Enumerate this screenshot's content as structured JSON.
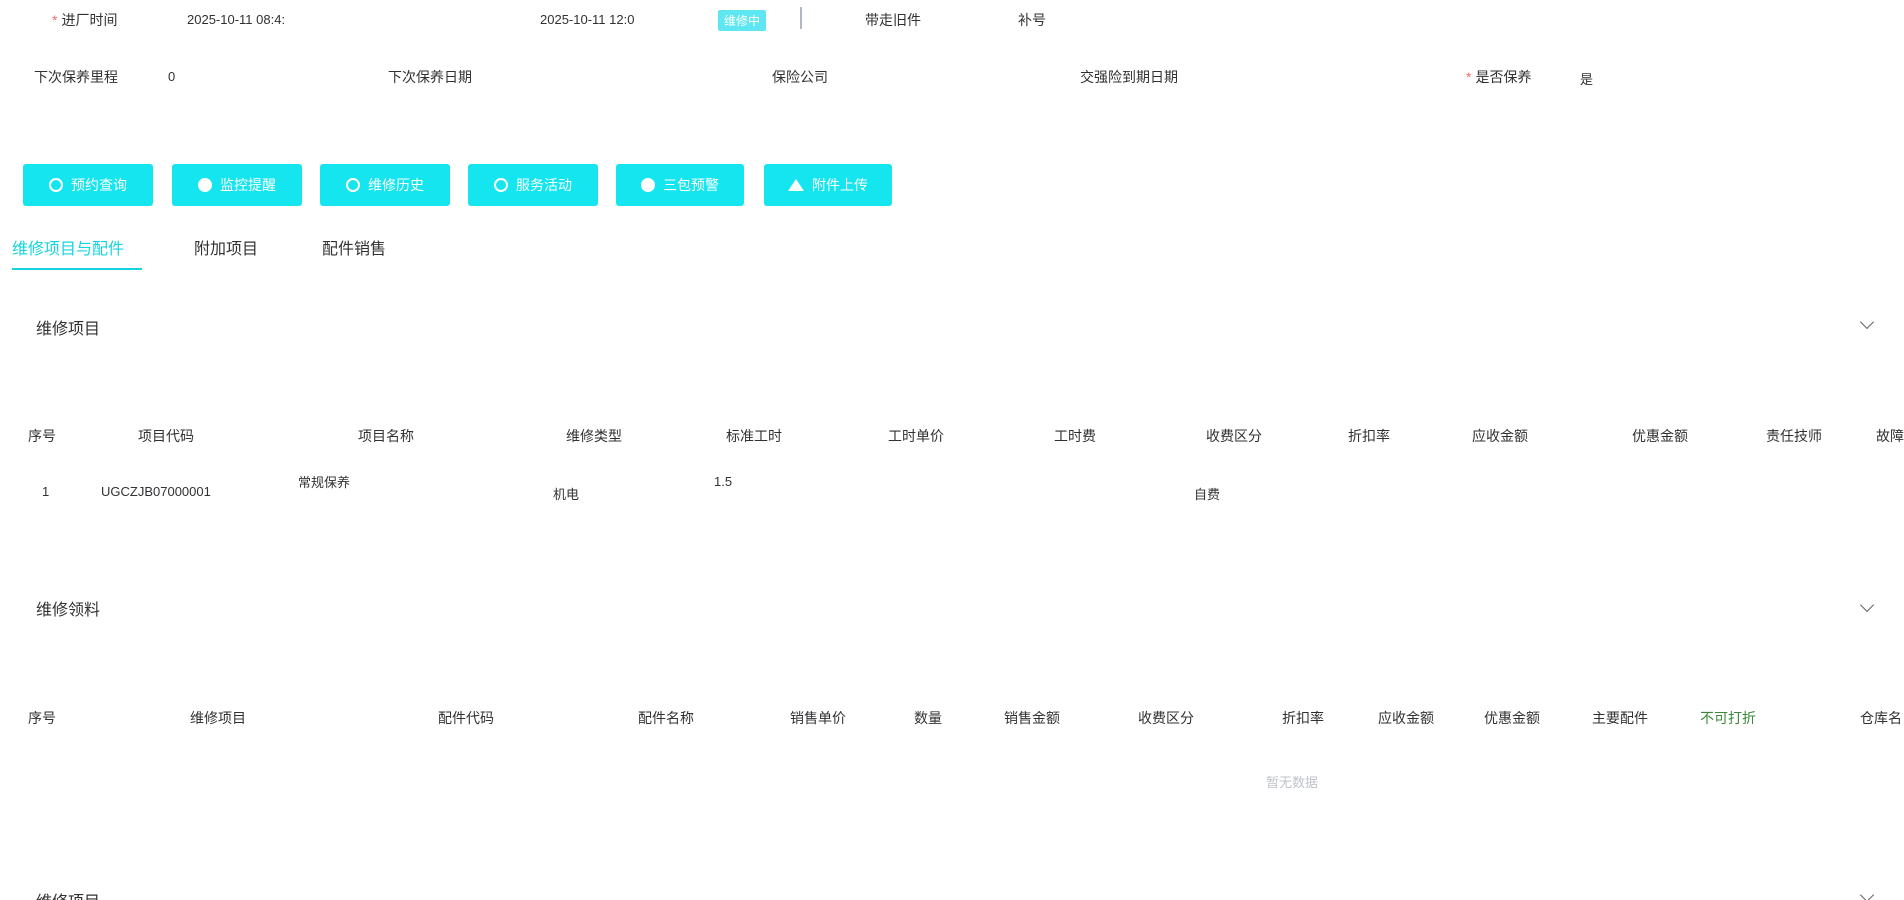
{
  "top_row": {
    "entry_time_label": "进厂时间",
    "entry_time_value": "2025-10-11 08:4:",
    "end_time_value": "2025-10-11 12:0",
    "status_badge": "维修中",
    "take_parts_label": "带走旧件",
    "plate_label": "补号"
  },
  "second_row": {
    "next_mileage_label": "下次保养里程",
    "next_mileage_value": "0",
    "next_date_label": "下次保养日期",
    "insurance_label": "保险公司",
    "insurance_expiry_label": "交强险到期日期",
    "is_maintenance_label": "是否保养",
    "is_maintenance_value": "是"
  },
  "toolbar": {
    "buttons": [
      {
        "label": "预约查询",
        "icon": "search-icon"
      },
      {
        "label": "监控提醒",
        "icon": "alert-icon"
      },
      {
        "label": "维修历史",
        "icon": "clock-icon"
      },
      {
        "label": "服务活动",
        "icon": "bell-icon"
      },
      {
        "label": "三包预警",
        "icon": "warning-icon"
      },
      {
        "label": "附件上传",
        "icon": "upload-icon"
      }
    ]
  },
  "tabs": [
    "维修项目与配件",
    "附加项目",
    "配件销售"
  ],
  "repair_items": {
    "title": "维修项目",
    "headers": [
      "序号",
      "项目代码",
      "项目名称",
      "维修类型",
      "标准工时",
      "工时单价",
      "工时费",
      "收费区分",
      "折扣率",
      "应收金额",
      "优惠金额",
      "责任技师",
      "故障"
    ],
    "rows": [
      {
        "no": "1",
        "code": "UGCZJB07000001",
        "name": "常规保养",
        "type": "机电",
        "hours": "1.5",
        "charge": "自费"
      }
    ]
  },
  "repair_materials": {
    "title": "维修领料",
    "headers": [
      "序号",
      "维修项目",
      "配件代码",
      "配件名称",
      "销售单价",
      "数量",
      "销售金额",
      "收费区分",
      "折扣率",
      "应收金额",
      "优惠金额",
      "主要配件",
      "不可打折",
      "仓库名"
    ],
    "empty_text": "暂无数据"
  },
  "third_section": {
    "title": "维修项目"
  }
}
